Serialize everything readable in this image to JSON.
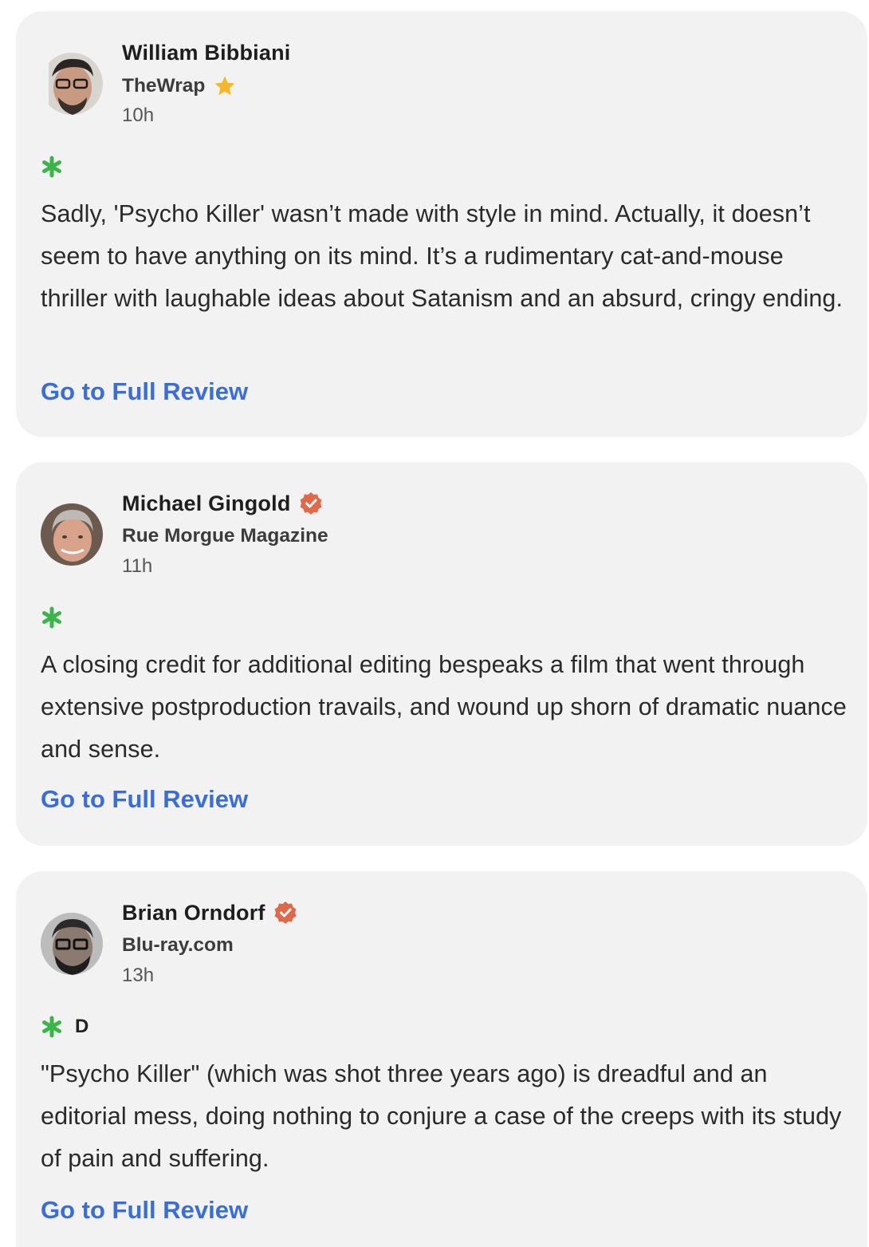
{
  "reviews": [
    {
      "critic": "William Bibbiani",
      "publication": "TheWrap",
      "badge": "star",
      "time": "10h",
      "grade": "",
      "quote": "Sadly, 'Psycho Killer' wasn’t made with style in mind. Actually, it doesn’t seem to have anything on its mind. It’s a rudimentary cat-and-mouse thriller with laughable ideas about Satanism and an absurd, cringy ending.",
      "link_label": "Go to Full Review"
    },
    {
      "critic": "Michael Gingold",
      "publication": "Rue Morgue Magazine",
      "badge": "verified",
      "time": "11h",
      "grade": "",
      "quote": "A closing credit for additional editing bespeaks a film that went through extensive postproduction travails, and wound up shorn of dramatic nuance and sense.",
      "link_label": "Go to Full Review"
    },
    {
      "critic": "Brian Orndorf",
      "publication": "Blu-ray.com",
      "badge": "verified",
      "time": "13h",
      "grade": "D",
      "quote": "\"Psycho Killer\" (which was shot three years ago) is dreadful and an editorial mess, doing nothing to conjure a case of the creeps with its study of pain and suffering.",
      "link_label": "Go to Full Review"
    }
  ],
  "colors": {
    "link": "#3b6ed4",
    "splat": "#3bb54a",
    "star": "#f5b72a",
    "verified": "#e0694a",
    "card_bg": "#f2f2f3"
  },
  "icons": {
    "rating": "rotten-splat-icon",
    "top_critic": "star-icon",
    "verified": "verified-check-icon"
  }
}
